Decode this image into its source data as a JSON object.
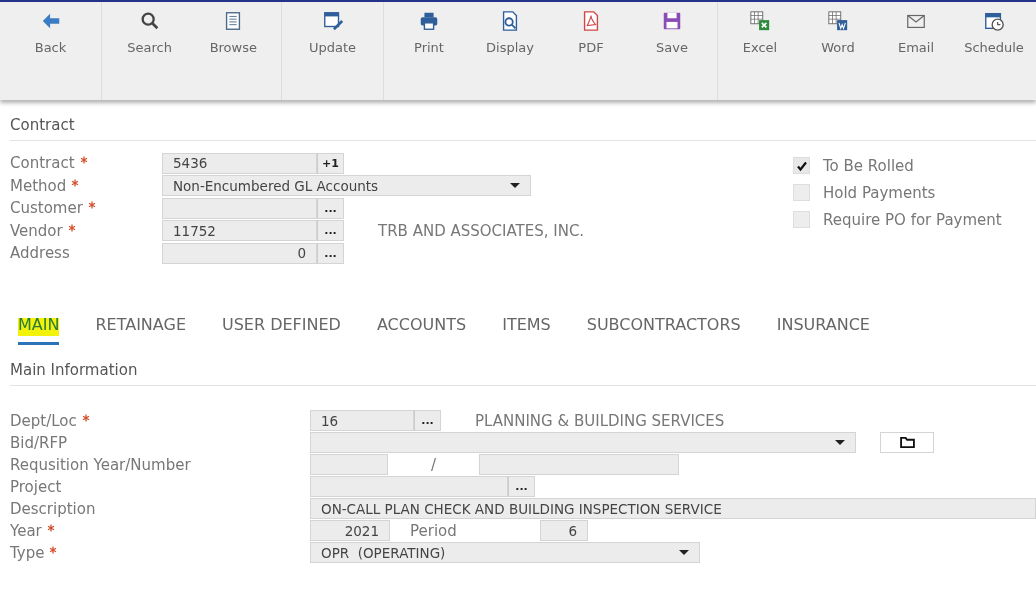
{
  "toolbar": {
    "groups": [
      [
        {
          "label": "Back"
        }
      ],
      [
        {
          "label": "Search"
        },
        {
          "label": "Browse"
        }
      ],
      [
        {
          "label": "Update"
        }
      ],
      [
        {
          "label": "Print"
        },
        {
          "label": "Display"
        },
        {
          "label": "PDF"
        },
        {
          "label": "Save"
        }
      ],
      [
        {
          "label": "Excel"
        },
        {
          "label": "Word"
        },
        {
          "label": "Email"
        },
        {
          "label": "Schedule"
        }
      ]
    ]
  },
  "contract": {
    "title": "Contract",
    "fields": [
      {
        "label": "Contract",
        "required": true,
        "kind": "lookup",
        "value": "5436",
        "button": "+1"
      },
      {
        "label": "Method",
        "required": true,
        "kind": "select",
        "value": "Non-Encumbered GL Accounts"
      },
      {
        "label": "Customer",
        "required": true,
        "kind": "lookup",
        "button": "..."
      },
      {
        "label": "Vendor",
        "required": true,
        "kind": "lookup",
        "value": "11752",
        "button": "...",
        "note": "TRB AND ASSOCIATES, INC."
      },
      {
        "label": "Address",
        "required": false,
        "kind": "lookup_number",
        "value": "0",
        "button": "..."
      }
    ],
    "options": [
      {
        "label": "To Be Rolled",
        "checked": true
      },
      {
        "label": "Hold Payments",
        "checked": false
      },
      {
        "label": "Require PO for Payment",
        "checked": false
      }
    ]
  },
  "tabs": [
    {
      "label": "MAIN",
      "selected": true
    },
    {
      "label": "RETAINAGE",
      "selected": false
    },
    {
      "label": "USER DEFINED",
      "selected": false
    },
    {
      "label": "ACCOUNTS",
      "selected": false
    },
    {
      "label": "ITEMS",
      "selected": false
    },
    {
      "label": "SUBCONTRACTORS",
      "selected": false
    },
    {
      "label": "INSURANCE",
      "selected": false
    }
  ],
  "main": {
    "title": "Main Information",
    "fields": [
      {
        "label": "Dept/Loc",
        "required": true,
        "kind": "lookup",
        "value": "16",
        "button": "...",
        "note": "PLANNING & BUILDING SERVICES"
      },
      {
        "label": "Bid/RFP",
        "required": false,
        "kind": "select_folder"
      },
      {
        "label": "Requsition Year/Number",
        "required": false,
        "kind": "pair",
        "separator": "/"
      },
      {
        "label": "Project",
        "required": false,
        "kind": "lookup",
        "button": "..."
      },
      {
        "label": "Description",
        "required": false,
        "kind": "text",
        "value": "ON-CALL PLAN CHECK AND BUILDING INSPECTION SERVICE"
      },
      {
        "label": "Year",
        "required": true,
        "kind": "year_period",
        "value": "2021",
        "label2": "Period",
        "value2": "6"
      },
      {
        "label": "Type",
        "required": true,
        "kind": "select",
        "value": "OPR  (OPERATING)"
      }
    ]
  }
}
